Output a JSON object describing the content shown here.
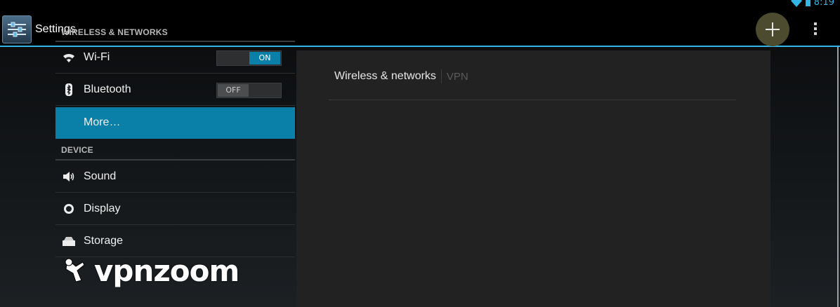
{
  "status_bar": {
    "time": "8:19"
  },
  "action_bar": {
    "title": "Settings",
    "app_icon": "settings-sliders-icon"
  },
  "colors": {
    "accent": "#33b5e5",
    "selected": "#0a7fa8"
  },
  "sections": [
    {
      "header": "WIRELESS & NETWORKS",
      "items": [
        {
          "label": "Wi-Fi",
          "icon": "wifi-icon",
          "toggle": "ON"
        },
        {
          "label": "Bluetooth",
          "icon": "bluetooth-icon",
          "toggle": "OFF"
        },
        {
          "label": "More…",
          "selected": true
        }
      ]
    },
    {
      "header": "DEVICE",
      "items": [
        {
          "label": "Sound",
          "icon": "speaker-icon"
        },
        {
          "label": "Display",
          "icon": "brightness-icon"
        },
        {
          "label": "Storage",
          "icon": "storage-icon"
        }
      ]
    }
  ],
  "detail": {
    "tabs": [
      {
        "label": "Wireless & networks",
        "active": true
      },
      {
        "label": "VPN",
        "active": false
      }
    ]
  },
  "watermark": {
    "text": "vpnzoom"
  }
}
